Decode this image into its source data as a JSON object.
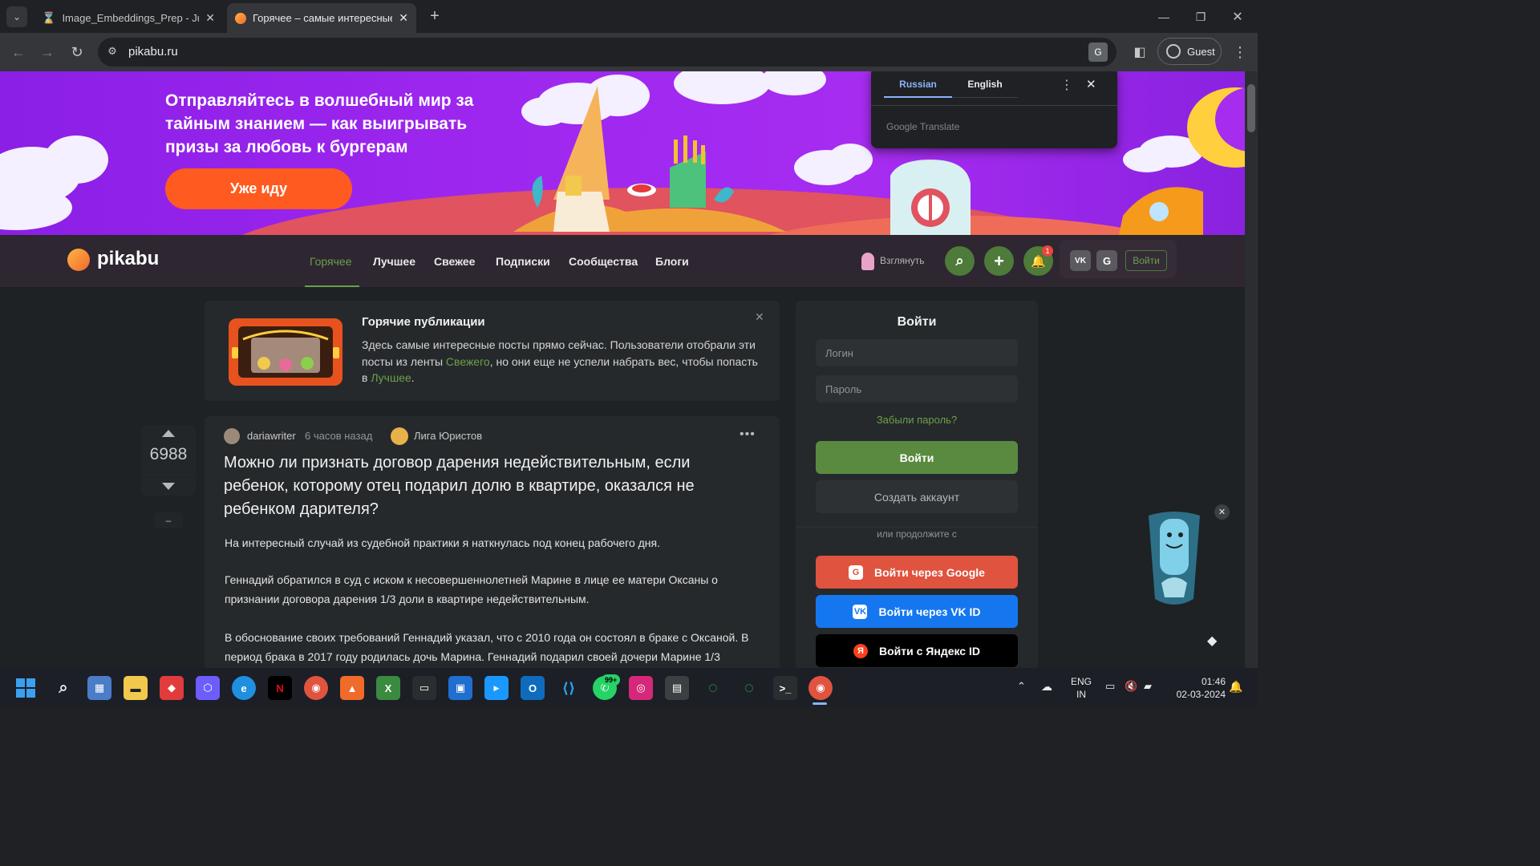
{
  "browser": {
    "tabs": [
      {
        "title": "Image_Embeddings_Prep - Jupy",
        "active": false
      },
      {
        "title": "Горячее – самые интересные",
        "active": true
      }
    ],
    "url": "pikabu.ru",
    "profile_label": "Guest"
  },
  "translate_popup": {
    "tabs": [
      "Russian",
      "English"
    ],
    "brand": "Google Translate"
  },
  "banner": {
    "text": "Отправляйтесь в волшебный мир за тайным знанием — как выигрывать призы за любовь к бургерам",
    "button": "Уже иду"
  },
  "site": {
    "logo": "pikabu",
    "nav": [
      "Горячее",
      "Лучшее",
      "Свежее",
      "Подписки",
      "Сообщества",
      "Блоги"
    ],
    "active_nav": "Горячее",
    "peek_label": "Взглянуть",
    "notification_count": "1",
    "login_button": "Войти",
    "accent": "#4e7a3a"
  },
  "hot_info": {
    "title": "Горячие публикации",
    "text_before": "Здесь самые интересные посты прямо сейчас. Пользователи отобрали эти посты из ленты ",
    "link1": "Свежего",
    "text_middle": ", но они еще не успели набрать вес, чтобы попасть в ",
    "link2": "Лучшее",
    "text_after": "."
  },
  "post": {
    "rating": "6988",
    "author": "dariawriter",
    "time": "6 часов назад",
    "community": "Лига Юристов",
    "title": "Можно ли признать договор дарения недействительным, если ребенок, которому отец подарил долю в квартире, оказался не ребенком дарителя?",
    "paragraphs": [
      "На интересный случай из судебной практики я наткнулась под конец рабочего дня.",
      "Геннадий обратился в суд с иском к несовершеннолетней Марине в лице ее матери Оксаны о признании договора дарения 1/3 доли в квартире недействительным.",
      "В обоснование своих требований Геннадий указал, что с 2010 года он состоял в браке с Оксаной. В период брака в 2017 году родилась дочь Марина. Геннадий подарил своей дочери Марине 1/3"
    ]
  },
  "login_panel": {
    "title": "Войти",
    "login_placeholder": "Логин",
    "password_placeholder": "Пароль",
    "forgot": "Забыли пароль?",
    "submit": "Войти",
    "create": "Создать аккаунт",
    "or": "или продолжите с",
    "google": "Войти через Google",
    "vk": "Войти через VK ID",
    "yandex": "Войти с Яндекс ID"
  },
  "taskbar": {
    "lang_line1": "ENG",
    "lang_line2": "IN",
    "time": "01:46",
    "date": "02-03-2024",
    "whatsapp_badge": "99+"
  }
}
